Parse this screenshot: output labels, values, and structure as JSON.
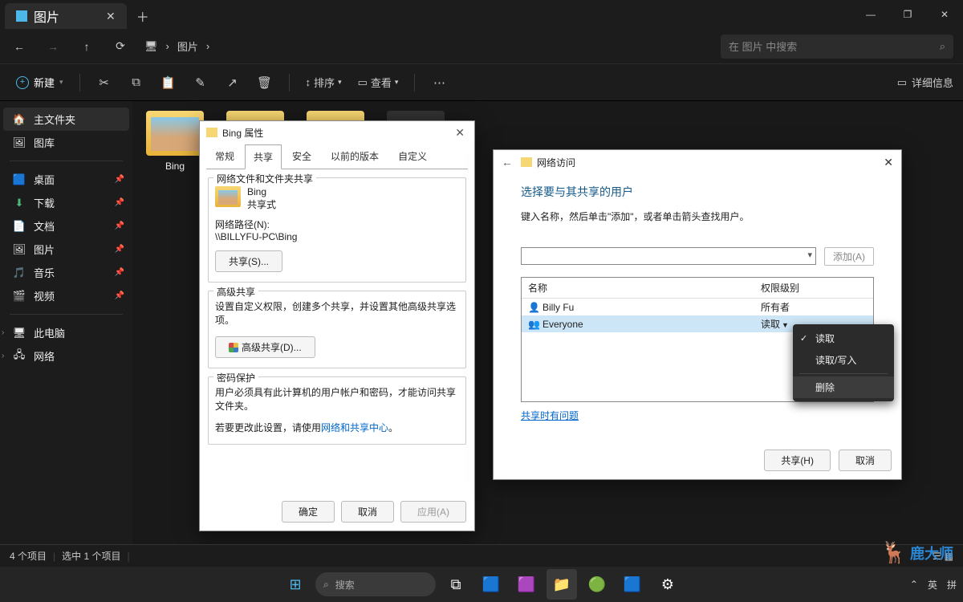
{
  "window": {
    "tab_title": "图片",
    "minimize": "―",
    "maximize": "❐",
    "close": "✕"
  },
  "nav": {
    "back": "←",
    "forward": "→",
    "up": "↑",
    "refresh": "⟳",
    "path_icon": "🖥",
    "path_sep": "›",
    "path_seg": "图片",
    "search_placeholder": "在 图片 中搜索",
    "search_icon": "⌕"
  },
  "toolbar": {
    "new": "新建",
    "cut": "✂",
    "copy": "⧉",
    "paste": "📋",
    "rename": "✎",
    "share": "↗",
    "delete": "🗑",
    "sort": "排序",
    "view": "查看",
    "more": "⋯",
    "details": "详细信息"
  },
  "sidebar": {
    "home": "主文件夹",
    "gallery": "图库",
    "items": [
      {
        "icon": "🟦",
        "label": "桌面"
      },
      {
        "icon": "⬇",
        "label": "下载"
      },
      {
        "icon": "📄",
        "label": "文档"
      },
      {
        "icon": "🖼",
        "label": "图片"
      },
      {
        "icon": "🎵",
        "label": "音乐"
      },
      {
        "icon": "🎬",
        "label": "视频"
      }
    ],
    "this_pc": "此电脑",
    "network": "网络"
  },
  "folders": [
    {
      "name": "Bing",
      "thumb": true
    }
  ],
  "prop_dialog": {
    "title": "Bing 属性",
    "tabs": [
      "常规",
      "共享",
      "安全",
      "以前的版本",
      "自定义"
    ],
    "active_tab": 1,
    "section1_title": "网络文件和文件夹共享",
    "folder_name": "Bing",
    "share_status": "共享式",
    "netpath_label": "网络路径(N):",
    "netpath": "\\\\BILLYFU-PC\\Bing",
    "share_btn": "共享(S)...",
    "section2_title": "高级共享",
    "adv_desc": "设置自定义权限，创建多个共享，并设置其他高级共享选项。",
    "adv_btn": "高级共享(D)...",
    "section3_title": "密码保护",
    "pw_line1": "用户必须具有此计算机的用户帐户和密码，才能访问共享文件夹。",
    "pw_line2a": "若要更改此设置，请使用",
    "pw_link": "网络和共享中心",
    "pw_line2b": "。",
    "ok": "确定",
    "cancel": "取消",
    "apply": "应用(A)"
  },
  "net_dialog": {
    "title": "网络访问",
    "heading": "选择要与其共享的用户",
    "subtext": "键入名称，然后单击\"添加\"，或者单击箭头查找用户。",
    "add_btn": "添加(A)",
    "col_name": "名称",
    "col_perm": "权限级别",
    "users": [
      {
        "name": "Billy Fu",
        "perm": "所有者"
      },
      {
        "name": "Everyone",
        "perm": "读取"
      }
    ],
    "help_link": "共享时有问题",
    "share_btn": "共享(H)",
    "cancel_btn": "取消"
  },
  "context_menu": {
    "read": "读取",
    "readwrite": "读取/写入",
    "remove": "删除"
  },
  "statusbar": {
    "count": "4 个项目",
    "selected": "选中 1 个项目"
  },
  "taskbar": {
    "search": "搜索",
    "ime1": "英",
    "ime2": "拼"
  },
  "watermark": "鹿大师"
}
